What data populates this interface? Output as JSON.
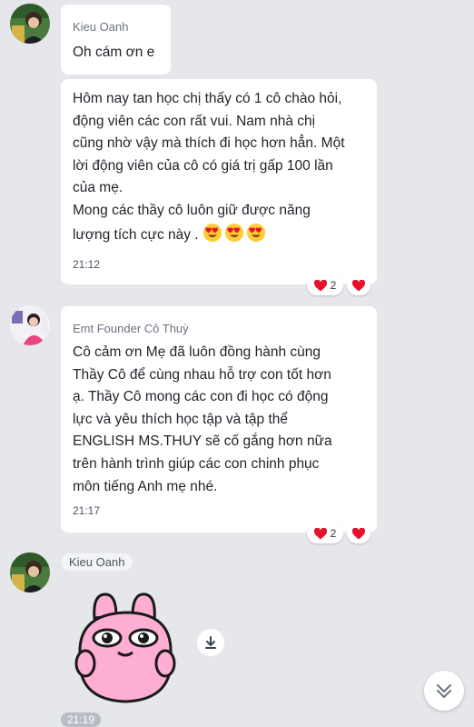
{
  "messages": [
    {
      "sender": "Kieu Oanh",
      "text": "Oh cám ơn e"
    },
    {
      "text": "Hôm nay tan học chị thấy có 1 cô chào hỏi,\nđộng viên các con rất vui. Nam nhà chị\ncũng nhờ vậy mà thích đi học hơn hẳn. Một\nlời động viên của cô có giá trị gấp 100 lần\ncủa mẹ.\nMong các thầy cô luôn giữ được năng\nlượng tích cực này .",
      "emojis": [
        "heart-eyes-emoji",
        "heart-eyes-emoji",
        "heart-eyes-emoji"
      ],
      "time": "21:12",
      "reaction_count": "2"
    },
    {
      "sender": "Emt Founder Cô Thuỳ",
      "text": "Cô cảm ơn Mẹ đã luôn đồng hành cùng\nThầy Cô để cùng nhau hỗ trợ con tốt hơn\nạ. Thầy Cô mong các con đi học có động\nlực và yêu thích học tập và tập thể\nENGLISH MS.THUY sẽ cố gắng hơn nữa\ntrên hành trình giúp các con chinh phục\nmôn tiếng Anh mẹ nhé.",
      "time": "21:17",
      "reaction_count": "2"
    },
    {
      "sender": "Kieu Oanh",
      "sticker": "pink-bunny-sticker",
      "time": "21:19"
    }
  ],
  "icons": {
    "reaction": "red-heart-icon",
    "download": "download-icon",
    "scroll": "double-chevron-down-icon"
  },
  "colors": {
    "background": "#e5e7eb",
    "bubble": "#ffffff",
    "heart": "#e8112d"
  }
}
